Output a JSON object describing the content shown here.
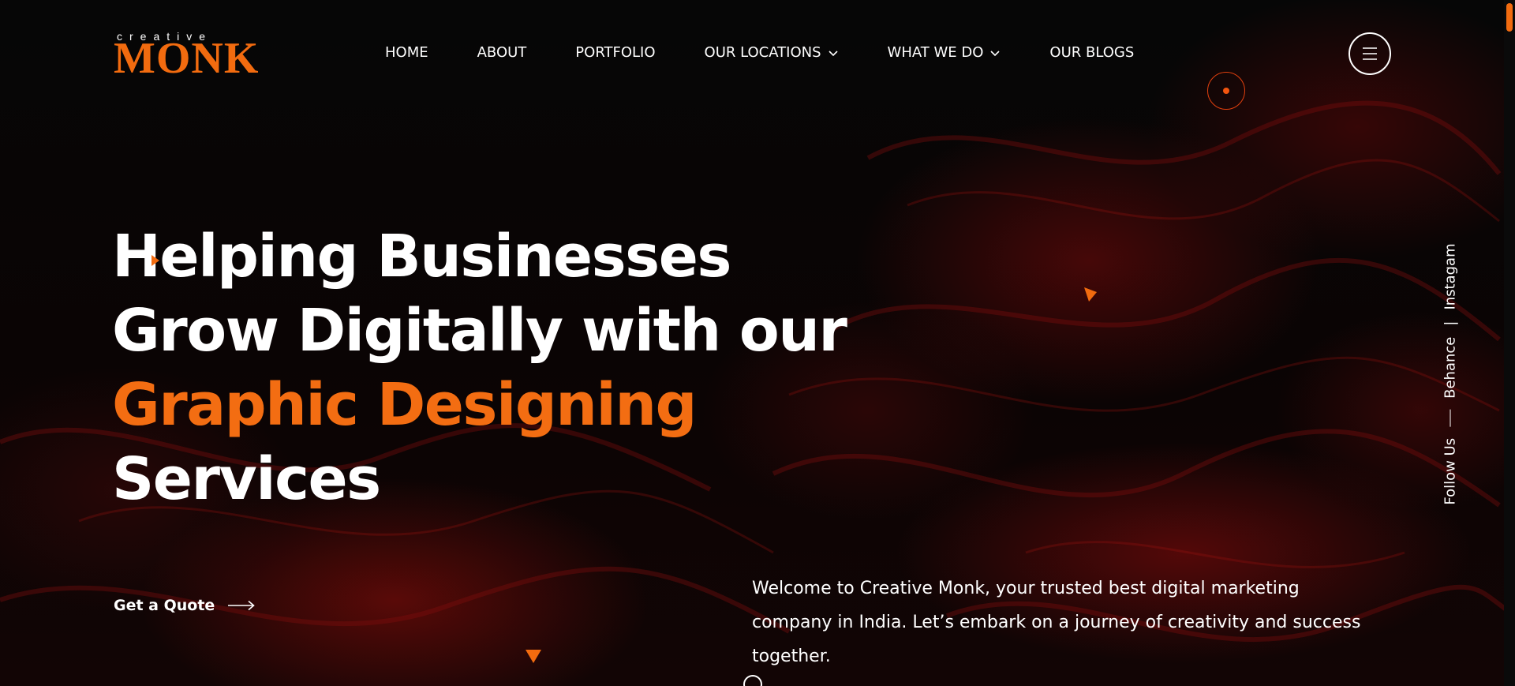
{
  "brand": {
    "logo_top": "creative",
    "logo_main": "MONK",
    "accent_color": "#f36d12"
  },
  "nav": {
    "items": [
      {
        "label": "HOME",
        "dropdown": false
      },
      {
        "label": "ABOUT",
        "dropdown": false
      },
      {
        "label": "PORTFOLIO",
        "dropdown": false
      },
      {
        "label": "OUR LOCATIONS",
        "dropdown": true
      },
      {
        "label": "WHAT WE DO",
        "dropdown": true
      },
      {
        "label": "OUR BLOGS",
        "dropdown": false
      }
    ],
    "menu_icon": "hamburger-icon"
  },
  "hero": {
    "headline_lines": [
      "Helping Businesses",
      "Grow Digitally with our",
      "Graphic Designing",
      "Services"
    ],
    "accent_line_index": 2,
    "cta_label": "Get a Quote",
    "cta_icon": "arrow-right-icon",
    "intro_text": "Welcome to Creative Monk, your trusted best digital marketing company in India. Let’s embark on a journey of creativity and success together."
  },
  "social": {
    "follow_label": "Follow Us",
    "links": [
      "Behance",
      "Instagam"
    ],
    "separator": "|"
  }
}
